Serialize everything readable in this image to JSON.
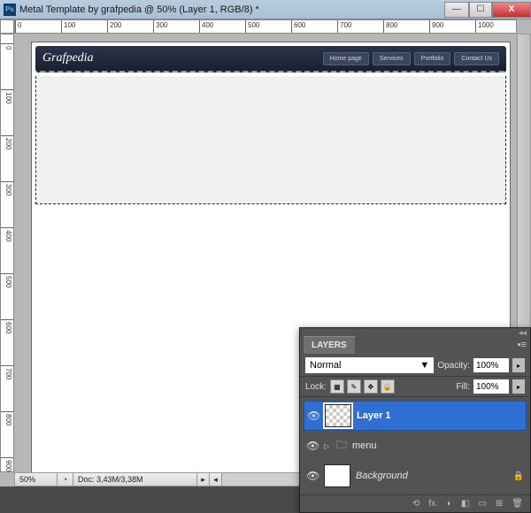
{
  "title": "Metal Template by grafpedia @ 50% (Layer 1, RGB/8) *",
  "win_buttons": {
    "min": "—",
    "max": "☐",
    "close": "X"
  },
  "ruler_h": [
    "0",
    "100",
    "200",
    "300",
    "400",
    "500",
    "600",
    "700",
    "800",
    "900",
    "1000"
  ],
  "ruler_v": [
    "0",
    "100",
    "200",
    "300",
    "400",
    "500",
    "600",
    "700",
    "800",
    "900"
  ],
  "zoom": "50%",
  "doc_status": "Doc: 3,43M/3,38M",
  "design": {
    "logo": "Grafpedia",
    "nav": [
      "Home page",
      "Services",
      "Portfolio",
      "Contact Us"
    ]
  },
  "layers_panel": {
    "tab": "LAYERS",
    "blend_mode": "Normal",
    "opacity_label": "Opacity:",
    "opacity_value": "100%",
    "lock_label": "Lock:",
    "fill_label": "Fill:",
    "fill_value": "100%",
    "layers": [
      {
        "name": "Layer 1",
        "selected": true,
        "type": "pixel"
      },
      {
        "name": "menu",
        "selected": false,
        "type": "group"
      },
      {
        "name": "Background",
        "selected": false,
        "type": "bg",
        "locked": true
      }
    ],
    "footer_icons": [
      "⟲",
      "fx.",
      "◐",
      "◧",
      "▭",
      "⊞",
      "🗑"
    ]
  }
}
